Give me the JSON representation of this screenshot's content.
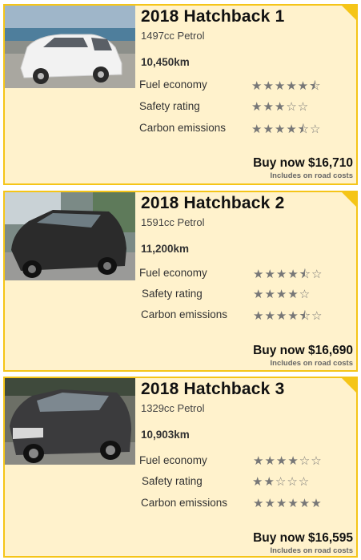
{
  "listings": [
    {
      "title": "2018 Hatchback 1",
      "engine": "1497cc Petrol",
      "mileage": "10,450km",
      "buy": "Buy now $16,710",
      "road": "Includes on road costs",
      "car_color": "#eeeeee",
      "ratings": [
        {
          "label": "Fuel economy",
          "stars": 5.5,
          "glyphs": "★★★★★⯪"
        },
        {
          "label": "Safety rating",
          "stars": 3,
          "glyphs": "★★★☆☆"
        },
        {
          "label": "Carbon emissions",
          "stars": 4.5,
          "glyphs": "★★★★⯪☆"
        }
      ]
    },
    {
      "title": "2018 Hatchback 2",
      "engine": "1591cc Petrol",
      "mileage": "11,200km",
      "buy": "Buy now $16,690",
      "road": "Includes on road costs",
      "car_color": "#2a2a2a",
      "ratings": [
        {
          "label": "Fuel economy",
          "stars": 4.5,
          "glyphs": "★★★★⯪☆"
        },
        {
          "label": "Safety rating",
          "stars": 4,
          "glyphs": "★★★★☆"
        },
        {
          "label": "Carbon emissions",
          "stars": 4.5,
          "glyphs": "★★★★⯪☆"
        }
      ]
    },
    {
      "title": "2018 Hatchback 3",
      "engine": "1329cc Petrol",
      "mileage": "10,903km",
      "buy": "Buy now $16,595",
      "road": "Includes on road costs",
      "car_color": "#3a3a3a",
      "ratings": [
        {
          "label": "Fuel economy",
          "stars": 4,
          "glyphs": "★★★★☆☆"
        },
        {
          "label": "Safety rating",
          "stars": 2,
          "glyphs": "★★☆☆☆"
        },
        {
          "label": "Carbon emissions",
          "stars": 6,
          "glyphs": "★★★★★★"
        }
      ]
    }
  ],
  "colors": {
    "card_bg": "#fff2cc",
    "card_border": "#f5c518",
    "star": "#777777"
  }
}
